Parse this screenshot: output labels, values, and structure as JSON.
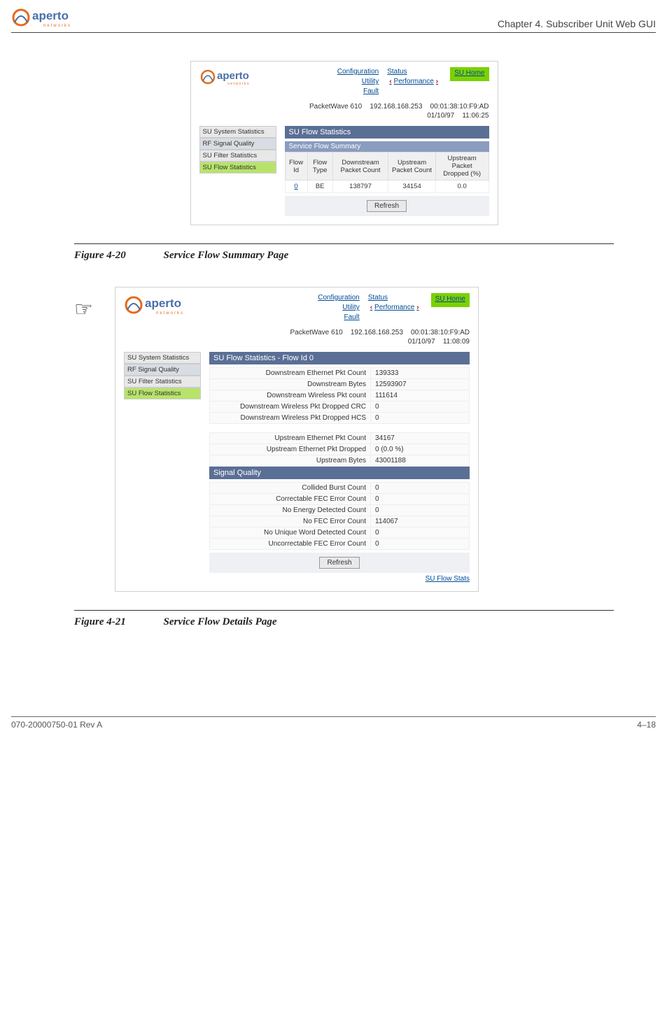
{
  "header": {
    "chapter": "Chapter 4.  Subscriber Unit Web GUI"
  },
  "figure1": {
    "caption_num": "Figure 4-20",
    "caption_text": "Service Flow Summary Page",
    "nav": {
      "c1a": "Configuration",
      "c1b": "Utility",
      "c1c": "Fault",
      "c2a": "Status",
      "c2b": "Performance",
      "home": "SU Home"
    },
    "info": {
      "device": "PacketWave 610",
      "ip": "192.168.168.253",
      "mac": "00:01:38:10:F9:AD",
      "date": "01/10/97",
      "time": "11:06:25"
    },
    "sidebar": {
      "a": "SU System Statistics",
      "b": "RF Signal Quality",
      "c": "SU Filter Statistics",
      "d": "SU Flow Statistics"
    },
    "panel": {
      "title": "SU Flow Statistics",
      "subtitle": "Service Flow Summary"
    },
    "table": {
      "h1": "Flow Id",
      "h2": "Flow Type",
      "h3": "Downstream Packet Count",
      "h4": "Upstream Packet Count",
      "h5": "Upstream Packet Dropped (%)",
      "r1c1": "0",
      "r1c2": "BE",
      "r1c3": "138797",
      "r1c4": "34154",
      "r1c5": "0.0"
    },
    "refresh": "Refresh"
  },
  "figure2": {
    "caption_num": "Figure 4-21",
    "caption_text": "Service Flow Details Page",
    "nav": {
      "c1a": "Configuration",
      "c1b": "Utility",
      "c1c": "Fault",
      "c2a": "Status",
      "c2b": "Performance",
      "home": "SU Home"
    },
    "info": {
      "device": "PacketWave 610",
      "ip": "192.168.168.253",
      "mac": "00:01:38:10:F9:AD",
      "date": "01/10/97",
      "time": "11:08:09"
    },
    "sidebar": {
      "a": "SU System Statistics",
      "b": "RF Signal Quality",
      "c": "SU Filter Statistics",
      "d": "SU Flow Statistics"
    },
    "panel1_title": "SU Flow Statistics - Flow Id 0",
    "kv1": {
      "k1": "Downstream Ethernet Pkt Count",
      "v1": "139333",
      "k2": "Downstream Bytes",
      "v2": "12593907",
      "k3": "Downstream Wireless Pkt count",
      "v3": "111614",
      "k4": "Downstream Wireless Pkt Dropped CRC",
      "v4": "0",
      "k5": "Downstream Wireless Pkt Dropped HCS",
      "v5": "0"
    },
    "kv2": {
      "k1": "Upstream Ethernet Pkt Count",
      "v1": "34167",
      "k2": "Upstream Ethernet Pkt Dropped",
      "v2": "0 (0.0 %)",
      "k3": "Upstream Bytes",
      "v3": "43001188"
    },
    "panel2_title": "Signal Quality",
    "kv3": {
      "k1": "Collided Burst Count",
      "v1": "0",
      "k2": "Correctable FEC Error Count",
      "v2": "0",
      "k3": "No Energy Detected Count",
      "v3": "0",
      "k4": "No FEC Error Count",
      "v4": "114067",
      "k5": "No Unique Word Detected Count",
      "v5": "0",
      "k6": "Uncorrectable FEC Error Count",
      "v6": "0"
    },
    "refresh": "Refresh",
    "backlink": "SU Flow Stats"
  },
  "footer": {
    "left": "070-20000750-01 Rev A",
    "right": "4–18"
  }
}
